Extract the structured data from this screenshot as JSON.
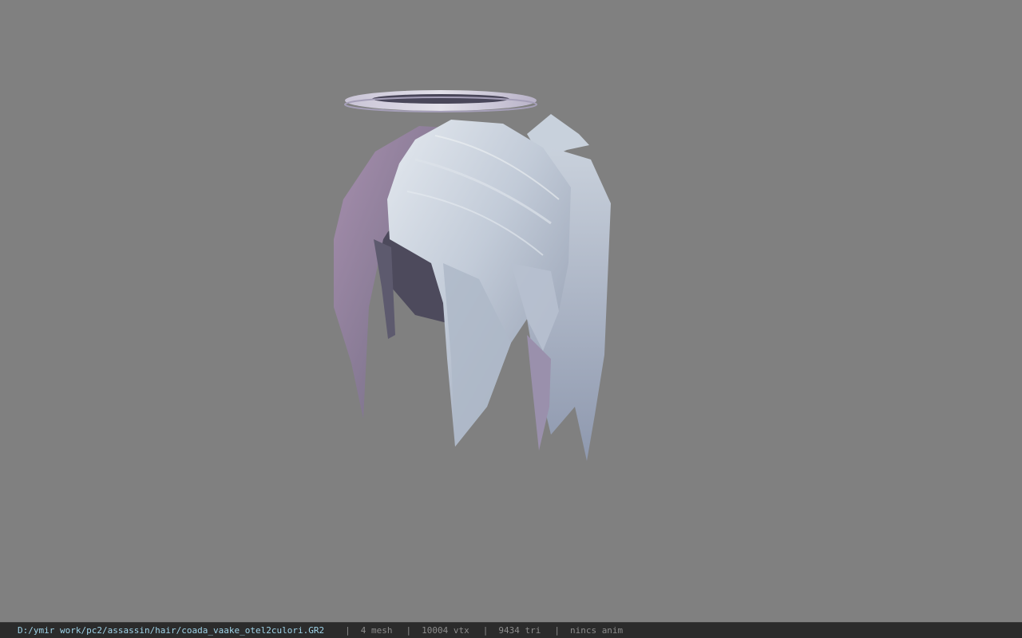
{
  "viewport": {
    "background": "#808080",
    "model": {
      "halo_colors": [
        "#c9c4d6",
        "#a59fb8",
        "#494659"
      ],
      "hair_colors": [
        "#c7d0dc",
        "#9aa4b8",
        "#a58ba8",
        "#5d5a6e"
      ]
    }
  },
  "status": {
    "path": "D:/ymir work/pc2/assassin/hair/coada_vaake_otel2culori.GR2",
    "separator": "|",
    "mesh": "4 mesh",
    "vtx": "10004 vtx",
    "tri": "9434 tri",
    "anim": "nincs anim",
    "path_color": "#9fd3e8",
    "text_color": "#8c8c8c"
  }
}
